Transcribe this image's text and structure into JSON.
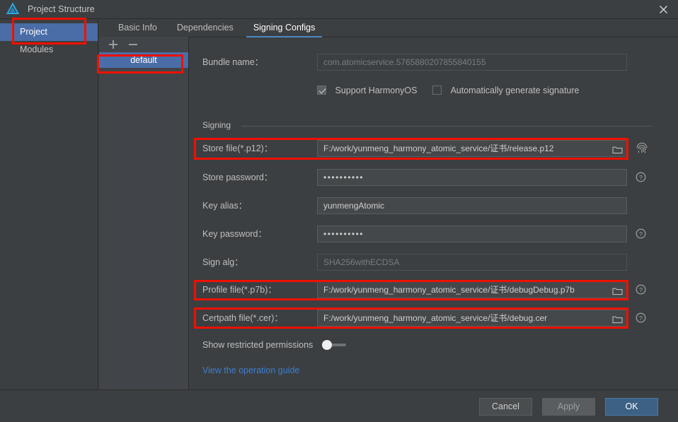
{
  "window": {
    "title": "Project Structure",
    "app_icon": "deveco-logo-icon",
    "close_label": "✕"
  },
  "sidebar": {
    "items": [
      {
        "label": "Project",
        "selected": true
      },
      {
        "label": "Modules",
        "selected": false
      }
    ]
  },
  "tabs": [
    {
      "label": "Basic Info",
      "active": false
    },
    {
      "label": "Dependencies",
      "active": false
    },
    {
      "label": "Signing Configs",
      "active": true
    }
  ],
  "config_list": {
    "add_label": "+",
    "remove_label": "−",
    "items": [
      {
        "label": "default",
        "selected": true
      }
    ]
  },
  "form": {
    "bundle_name": {
      "label": "Bundle name：",
      "value": "com.atomicservice.5765880207855840155",
      "disabled": true
    },
    "checkboxes": [
      {
        "label": "Support HarmonyOS",
        "checked": true
      },
      {
        "label": "Automatically generate signature",
        "checked": false
      }
    ],
    "section_title": "Signing",
    "fields": [
      {
        "label": "Store file(*.p12)：",
        "value": "F:/work/yunmeng_harmony_atomic_service/证书/release.p12",
        "kind": "file",
        "icon": "folder-icon",
        "trailing": "fingerprint-icon",
        "highlighted": true
      },
      {
        "label": "Store password：",
        "value": "••••••••••",
        "kind": "password",
        "trailing": "help-icon",
        "highlighted": false
      },
      {
        "label": "Key alias：",
        "value": "yunmengAtomic",
        "kind": "text",
        "trailing": "",
        "highlighted": false
      },
      {
        "label": "Key password：",
        "value": "••••••••••",
        "kind": "password",
        "trailing": "help-icon",
        "highlighted": false
      },
      {
        "label": "Sign alg：",
        "value": "SHA256withECDSA",
        "kind": "text",
        "disabled": true,
        "trailing": "",
        "highlighted": false
      },
      {
        "label": "Profile file(*.p7b)：",
        "value": "F:/work/yunmeng_harmony_atomic_service/证书/debugDebug.p7b",
        "kind": "file",
        "icon": "folder-icon",
        "trailing": "help-icon",
        "highlighted": true
      },
      {
        "label": "Certpath file(*.cer)：",
        "value": "F:/work/yunmeng_harmony_atomic_service/证书/debug.cer",
        "kind": "file",
        "icon": "folder-icon",
        "trailing": "help-icon",
        "highlighted": true
      }
    ],
    "restricted_permissions": {
      "label": "Show restricted permissions",
      "enabled": false
    },
    "guide_link": "View the operation guide"
  },
  "footer": {
    "cancel": "Cancel",
    "apply": "Apply",
    "ok": "OK"
  },
  "colors": {
    "accent_blue": "#4a6da7",
    "tab_underline": "#4a88c7",
    "annotation_red": "#f01000",
    "link_blue": "#3d7ecf",
    "ok_button": "#3d6185",
    "window_bg": "#3c3f41"
  }
}
